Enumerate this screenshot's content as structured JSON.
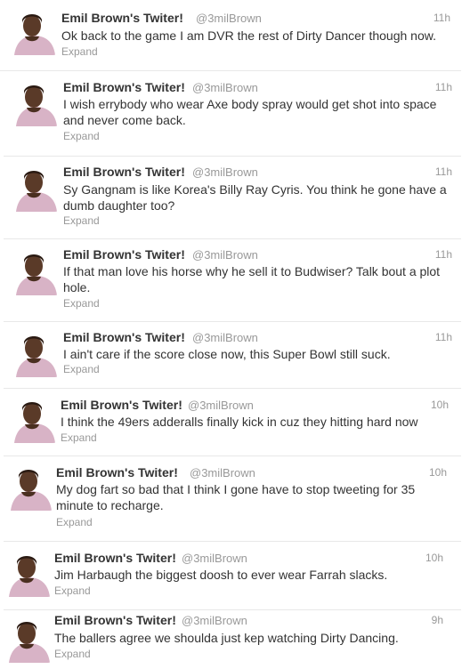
{
  "tweets": [
    {
      "name": "Emil Brown's Twiter!",
      "handle": "@3milBrown",
      "time": "11h",
      "text": "Ok back to the game I am DVR the rest of Dirty Dancer though now.",
      "expand": "Expand"
    },
    {
      "name": "Emil Brown's Twiter!",
      "handle": "@3milBrown",
      "time": "11h",
      "text": "I wish errybody who wear Axe body spray would get shot into space\nand never come back.",
      "expand": "Expand"
    },
    {
      "name": "Emil Brown's Twiter!",
      "handle": "@3milBrown",
      "time": "11h",
      "text": "Sy Gangnam is like Korea's Billy Ray Cyris. You think he gone have a\ndumb daughter too?",
      "expand": "Expand"
    },
    {
      "name": "Emil Brown's Twiter!",
      "handle": "@3milBrown",
      "time": "11h",
      "text": "If that man love his horse why he sell it to Budwiser? Talk bout a plot\nhole.",
      "expand": "Expand"
    },
    {
      "name": "Emil Brown's Twiter!",
      "handle": "@3milBrown",
      "time": "11h",
      "text": "I ain't care if the score close now, this Super Bowl still suck.",
      "expand": "Expand"
    },
    {
      "name": "Emil Brown's Twiter!",
      "handle": "@3milBrown",
      "time": "10h",
      "text": "I think the 49ers adderalls finally kick in cuz they hitting hard now",
      "expand": "Expand"
    },
    {
      "name": "Emil Brown's Twiter!",
      "handle": "@3milBrown",
      "time": "10h",
      "text": "My dog fart so bad that I think I gone have to stop tweeting for 35\nminute to recharge.",
      "expand": "Expand"
    },
    {
      "name": "Emil Brown's Twiter!",
      "handle": "@3milBrown",
      "time": "10h",
      "text": "Jim Harbaugh the biggest doosh to ever wear Farrah slacks.",
      "expand": "Expand"
    },
    {
      "name": "Emil Brown's Twiter!",
      "handle": "@3milBrown",
      "time": "9h",
      "text": "The ballers agree we shoulda just kep watching Dirty Dancing.",
      "expand": "Expand"
    }
  ],
  "colors": {
    "text": "#333333",
    "meta": "#999999",
    "divider": "#e8e8e8"
  },
  "icons": {
    "avatar": "profile-photo"
  }
}
